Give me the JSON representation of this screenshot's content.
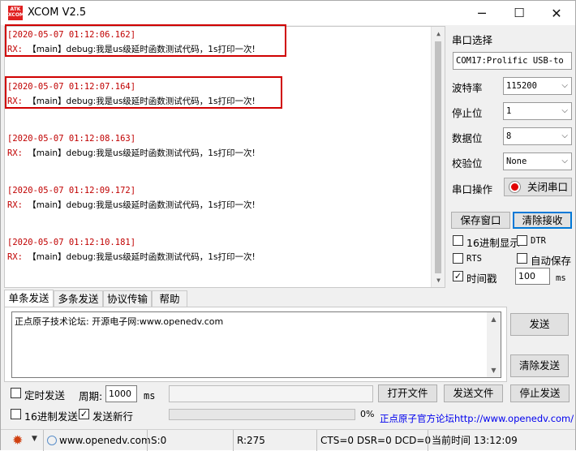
{
  "window": {
    "title": "XCOM V2.5",
    "logo_text_top": "ATK",
    "logo_text_bottom": "XCOM",
    "minimize": "─",
    "maximize": "☐",
    "close": "✕"
  },
  "receive": {
    "rx_prefix": "RX:",
    "lines": [
      {
        "timestamp": "[2020-05-07 01:12:06.162]",
        "message": "【main】debug:我是us级延时函数测试代码，1s打印一次!"
      },
      {
        "timestamp": "[2020-05-07 01:12:07.164]",
        "message": "【main】debug:我是us级延时函数测试代码，1s打印一次!"
      },
      {
        "timestamp": "[2020-05-07 01:12:08.163]",
        "message": "【main】debug:我是us级延时函数测试代码，1s打印一次!"
      },
      {
        "timestamp": "[2020-05-07 01:12:09.172]",
        "message": "【main】debug:我是us级延时函数测试代码，1s打印一次!"
      },
      {
        "timestamp": "[2020-05-07 01:12:10.181]",
        "message": "【main】debug:我是us级延时函数测试代码，1s打印一次!"
      }
    ]
  },
  "settings": {
    "port_select_label": "串口选择",
    "port_value": "COM17:Prolific USB-to",
    "baud_label": "波特率",
    "baud_value": "115200",
    "stopbits_label": "停止位",
    "stopbits_value": "1",
    "databits_label": "数据位",
    "databits_value": "8",
    "parity_label": "校验位",
    "parity_value": "None",
    "port_op_label": "串口操作",
    "close_port_button": "关闭串口",
    "save_window_button": "保存窗口",
    "clear_recv_button": "清除接收",
    "hex_display_label": "16进制显示",
    "dtr_label": "DTR",
    "rts_label": "RTS",
    "autosave_label": "自动保存",
    "timestamp_label": "时间戳",
    "timestamp_value": "100",
    "timestamp_unit": "ms",
    "timestamp_checked": "✓"
  },
  "tabs": [
    "单条发送",
    "多条发送",
    "协议传输",
    "帮助"
  ],
  "send": {
    "text": "正点原子技术论坛: 开源电子网:www.openedv.com",
    "send_button": "发送",
    "clear_send_button": "清除发送",
    "timed_send_label": "定时发送",
    "period_label": "周期:",
    "period_value": "1000",
    "period_unit": "ms",
    "open_file_button": "打开文件",
    "send_file_button": "发送文件",
    "stop_send_button": "停止发送",
    "hex_send_label": "16进制发送",
    "send_newline_label": "发送新行",
    "send_newline_checked": "✓",
    "progress_percent": 0,
    "progress_label": "0%",
    "official_link": "正点原子官方论坛http://www.openedv.com/"
  },
  "status": {
    "website": "www.openedv.com",
    "sent": "S:0",
    "received": "R:275",
    "signals": "CTS=0 DSR=0 DCD=0",
    "current_time": "当前时间 13:12:09"
  },
  "colors": {
    "timestamp": "#c00000",
    "highlight_box": "#d00000",
    "link": "#0000ee",
    "close_port_indicator": "#e00000"
  }
}
